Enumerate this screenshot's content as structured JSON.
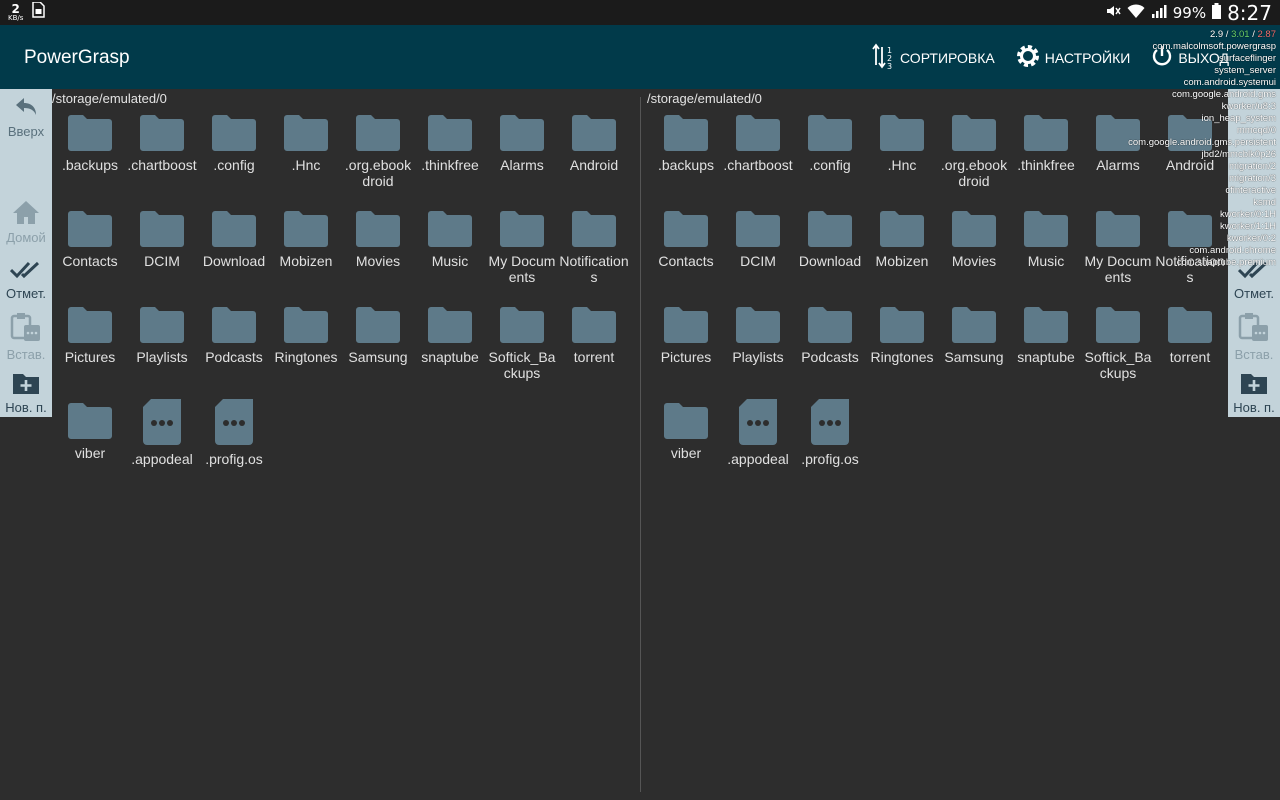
{
  "statusbar": {
    "speed_value": "2",
    "speed_unit": "KB/s",
    "battery": "99%",
    "time": "8:27"
  },
  "app": {
    "title": "PowerGrasp"
  },
  "actions": {
    "sort": "СОРТИРОВКА",
    "settings": "НАСТРОЙКИ",
    "exit": "ВЫХОД"
  },
  "toolbar_left": {
    "up": "Вверх",
    "home": "Домой",
    "mark": "Отмет.",
    "paste": "Встав.",
    "new_folder": "Нов. п."
  },
  "toolbar_right": {
    "mark": "Отмет.",
    "paste": "Встав.",
    "new_folder": "Нов. п."
  },
  "panes": {
    "left": {
      "path": "/storage/emulated/0",
      "items": [
        {
          "name": ".backups",
          "type": "folder"
        },
        {
          "name": ".chartboost",
          "type": "folder"
        },
        {
          "name": ".config",
          "type": "folder"
        },
        {
          "name": ".Hnc",
          "type": "folder"
        },
        {
          "name": ".org.ebookdroid",
          "type": "folder"
        },
        {
          "name": ".thinkfree",
          "type": "folder"
        },
        {
          "name": "Alarms",
          "type": "folder"
        },
        {
          "name": "Android",
          "type": "folder"
        },
        {
          "name": "Contacts",
          "type": "folder"
        },
        {
          "name": "DCIM",
          "type": "folder"
        },
        {
          "name": "Download",
          "type": "folder"
        },
        {
          "name": "Mobizen",
          "type": "folder"
        },
        {
          "name": "Movies",
          "type": "folder"
        },
        {
          "name": "Music",
          "type": "folder"
        },
        {
          "name": "My Documents",
          "type": "folder"
        },
        {
          "name": "Notifications",
          "type": "folder"
        },
        {
          "name": "Pictures",
          "type": "folder"
        },
        {
          "name": "Playlists",
          "type": "folder"
        },
        {
          "name": "Podcasts",
          "type": "folder"
        },
        {
          "name": "Ringtones",
          "type": "folder"
        },
        {
          "name": "Samsung",
          "type": "folder"
        },
        {
          "name": "snaptube",
          "type": "folder"
        },
        {
          "name": "Softick_Backups",
          "type": "folder"
        },
        {
          "name": "torrent",
          "type": "folder"
        },
        {
          "name": "viber",
          "type": "folder"
        },
        {
          "name": ".appodeal",
          "type": "file"
        },
        {
          "name": ".profig.os",
          "type": "file"
        }
      ]
    },
    "right": {
      "path": "/storage/emulated/0",
      "items": [
        {
          "name": ".backups",
          "type": "folder"
        },
        {
          "name": ".chartboost",
          "type": "folder"
        },
        {
          "name": ".config",
          "type": "folder"
        },
        {
          "name": ".Hnc",
          "type": "folder"
        },
        {
          "name": ".org.ebookdroid",
          "type": "folder"
        },
        {
          "name": ".thinkfree",
          "type": "folder"
        },
        {
          "name": "Alarms",
          "type": "folder"
        },
        {
          "name": "Android",
          "type": "folder"
        },
        {
          "name": "Contacts",
          "type": "folder"
        },
        {
          "name": "DCIM",
          "type": "folder"
        },
        {
          "name": "Download",
          "type": "folder"
        },
        {
          "name": "Mobizen",
          "type": "folder"
        },
        {
          "name": "Movies",
          "type": "folder"
        },
        {
          "name": "Music",
          "type": "folder"
        },
        {
          "name": "My Documents",
          "type": "folder"
        },
        {
          "name": "Notifications",
          "type": "folder"
        },
        {
          "name": "Pictures",
          "type": "folder"
        },
        {
          "name": "Playlists",
          "type": "folder"
        },
        {
          "name": "Podcasts",
          "type": "folder"
        },
        {
          "name": "Ringtones",
          "type": "folder"
        },
        {
          "name": "Samsung",
          "type": "folder"
        },
        {
          "name": "snaptube",
          "type": "folder"
        },
        {
          "name": "Softick_Backups",
          "type": "folder"
        },
        {
          "name": "torrent",
          "type": "folder"
        },
        {
          "name": "viber",
          "type": "folder"
        },
        {
          "name": ".appodeal",
          "type": "file"
        },
        {
          "name": ".profig.os",
          "type": "file"
        }
      ]
    }
  },
  "process_overlay": {
    "load": [
      "2.9",
      "3.01",
      "2.87"
    ],
    "processes": [
      "com.malcolmsoft.powergrasp",
      "surfaceflinger",
      "system_server",
      "com.android.systemui",
      "com.google.android.gms",
      "kworker/u8:3",
      "ion_heap_system",
      "mmcqd/0",
      "com.google.android.gms.persistent",
      "jbd2/mmcblk0p26",
      "migration/2",
      "migration/3",
      "cfinteractive",
      "ksmd",
      "kworker/0:1H",
      "kworker/1:1H",
      "kworker/0:2",
      "com.android.chrome",
      "com.snaptube.premium"
    ]
  },
  "colors": {
    "appbar": "#013a4a",
    "background": "#2d2d2d",
    "toolbar": "#c3d3da",
    "folder": "#5e7a89"
  }
}
